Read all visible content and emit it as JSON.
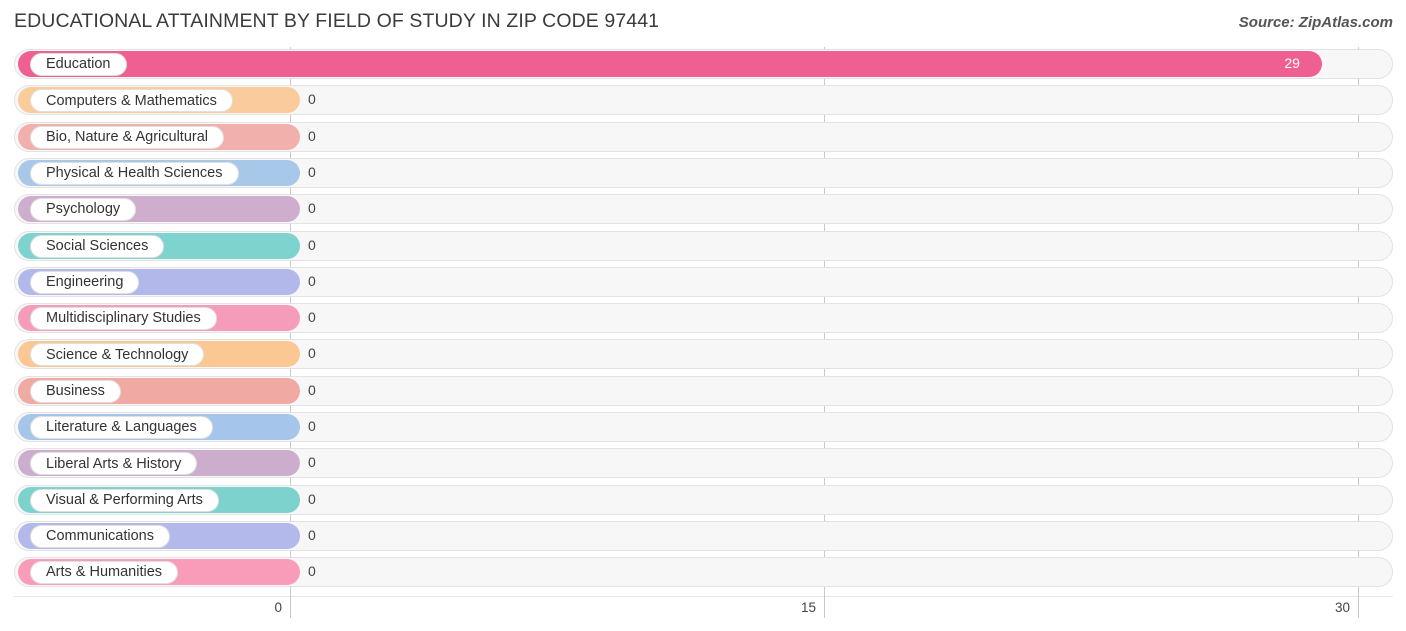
{
  "header": {
    "title": "EDUCATIONAL ATTAINMENT BY FIELD OF STUDY IN ZIP CODE 97441",
    "source": "Source: ZipAtlas.com"
  },
  "chart_data": {
    "type": "bar",
    "orientation": "horizontal",
    "title": "EDUCATIONAL ATTAINMENT BY FIELD OF STUDY IN ZIP CODE 97441",
    "xlabel": "",
    "ylabel": "",
    "xlim": [
      0,
      30
    ],
    "xticks": [
      0,
      15,
      30
    ],
    "xtick_labels": [
      "0",
      "15",
      "30"
    ],
    "grid": true,
    "legend": "none",
    "categories": [
      "Education",
      "Computers & Mathematics",
      "Bio, Nature & Agricultural",
      "Physical & Health Sciences",
      "Psychology",
      "Social Sciences",
      "Engineering",
      "Multidisciplinary Studies",
      "Science & Technology",
      "Business",
      "Literature & Languages",
      "Liberal Arts & History",
      "Visual & Performing Arts",
      "Communications",
      "Arts & Humanities"
    ],
    "values": [
      29,
      0,
      0,
      0,
      0,
      0,
      0,
      0,
      0,
      0,
      0,
      0,
      0,
      0,
      0
    ],
    "value_labels": [
      "29",
      "0",
      "0",
      "0",
      "0",
      "0",
      "0",
      "0",
      "0",
      "0",
      "0",
      "0",
      "0",
      "0",
      "0"
    ],
    "colors": [
      "#ef5f91",
      "#fbcc9b",
      "#f2b0ad",
      "#a8c8ea",
      "#cfadcd",
      "#7fd3cf",
      "#b2b8ea",
      "#f59cba",
      "#fbc894",
      "#f0a9a3",
      "#a5c6ea",
      "#cdadcd",
      "#7ed2ce",
      "#b3b9ea",
      "#f89cba"
    ]
  },
  "axis": {
    "ticks": [
      {
        "label": "0",
        "value": 0
      },
      {
        "label": "15",
        "value": 15
      },
      {
        "label": "30",
        "value": 30
      }
    ]
  }
}
